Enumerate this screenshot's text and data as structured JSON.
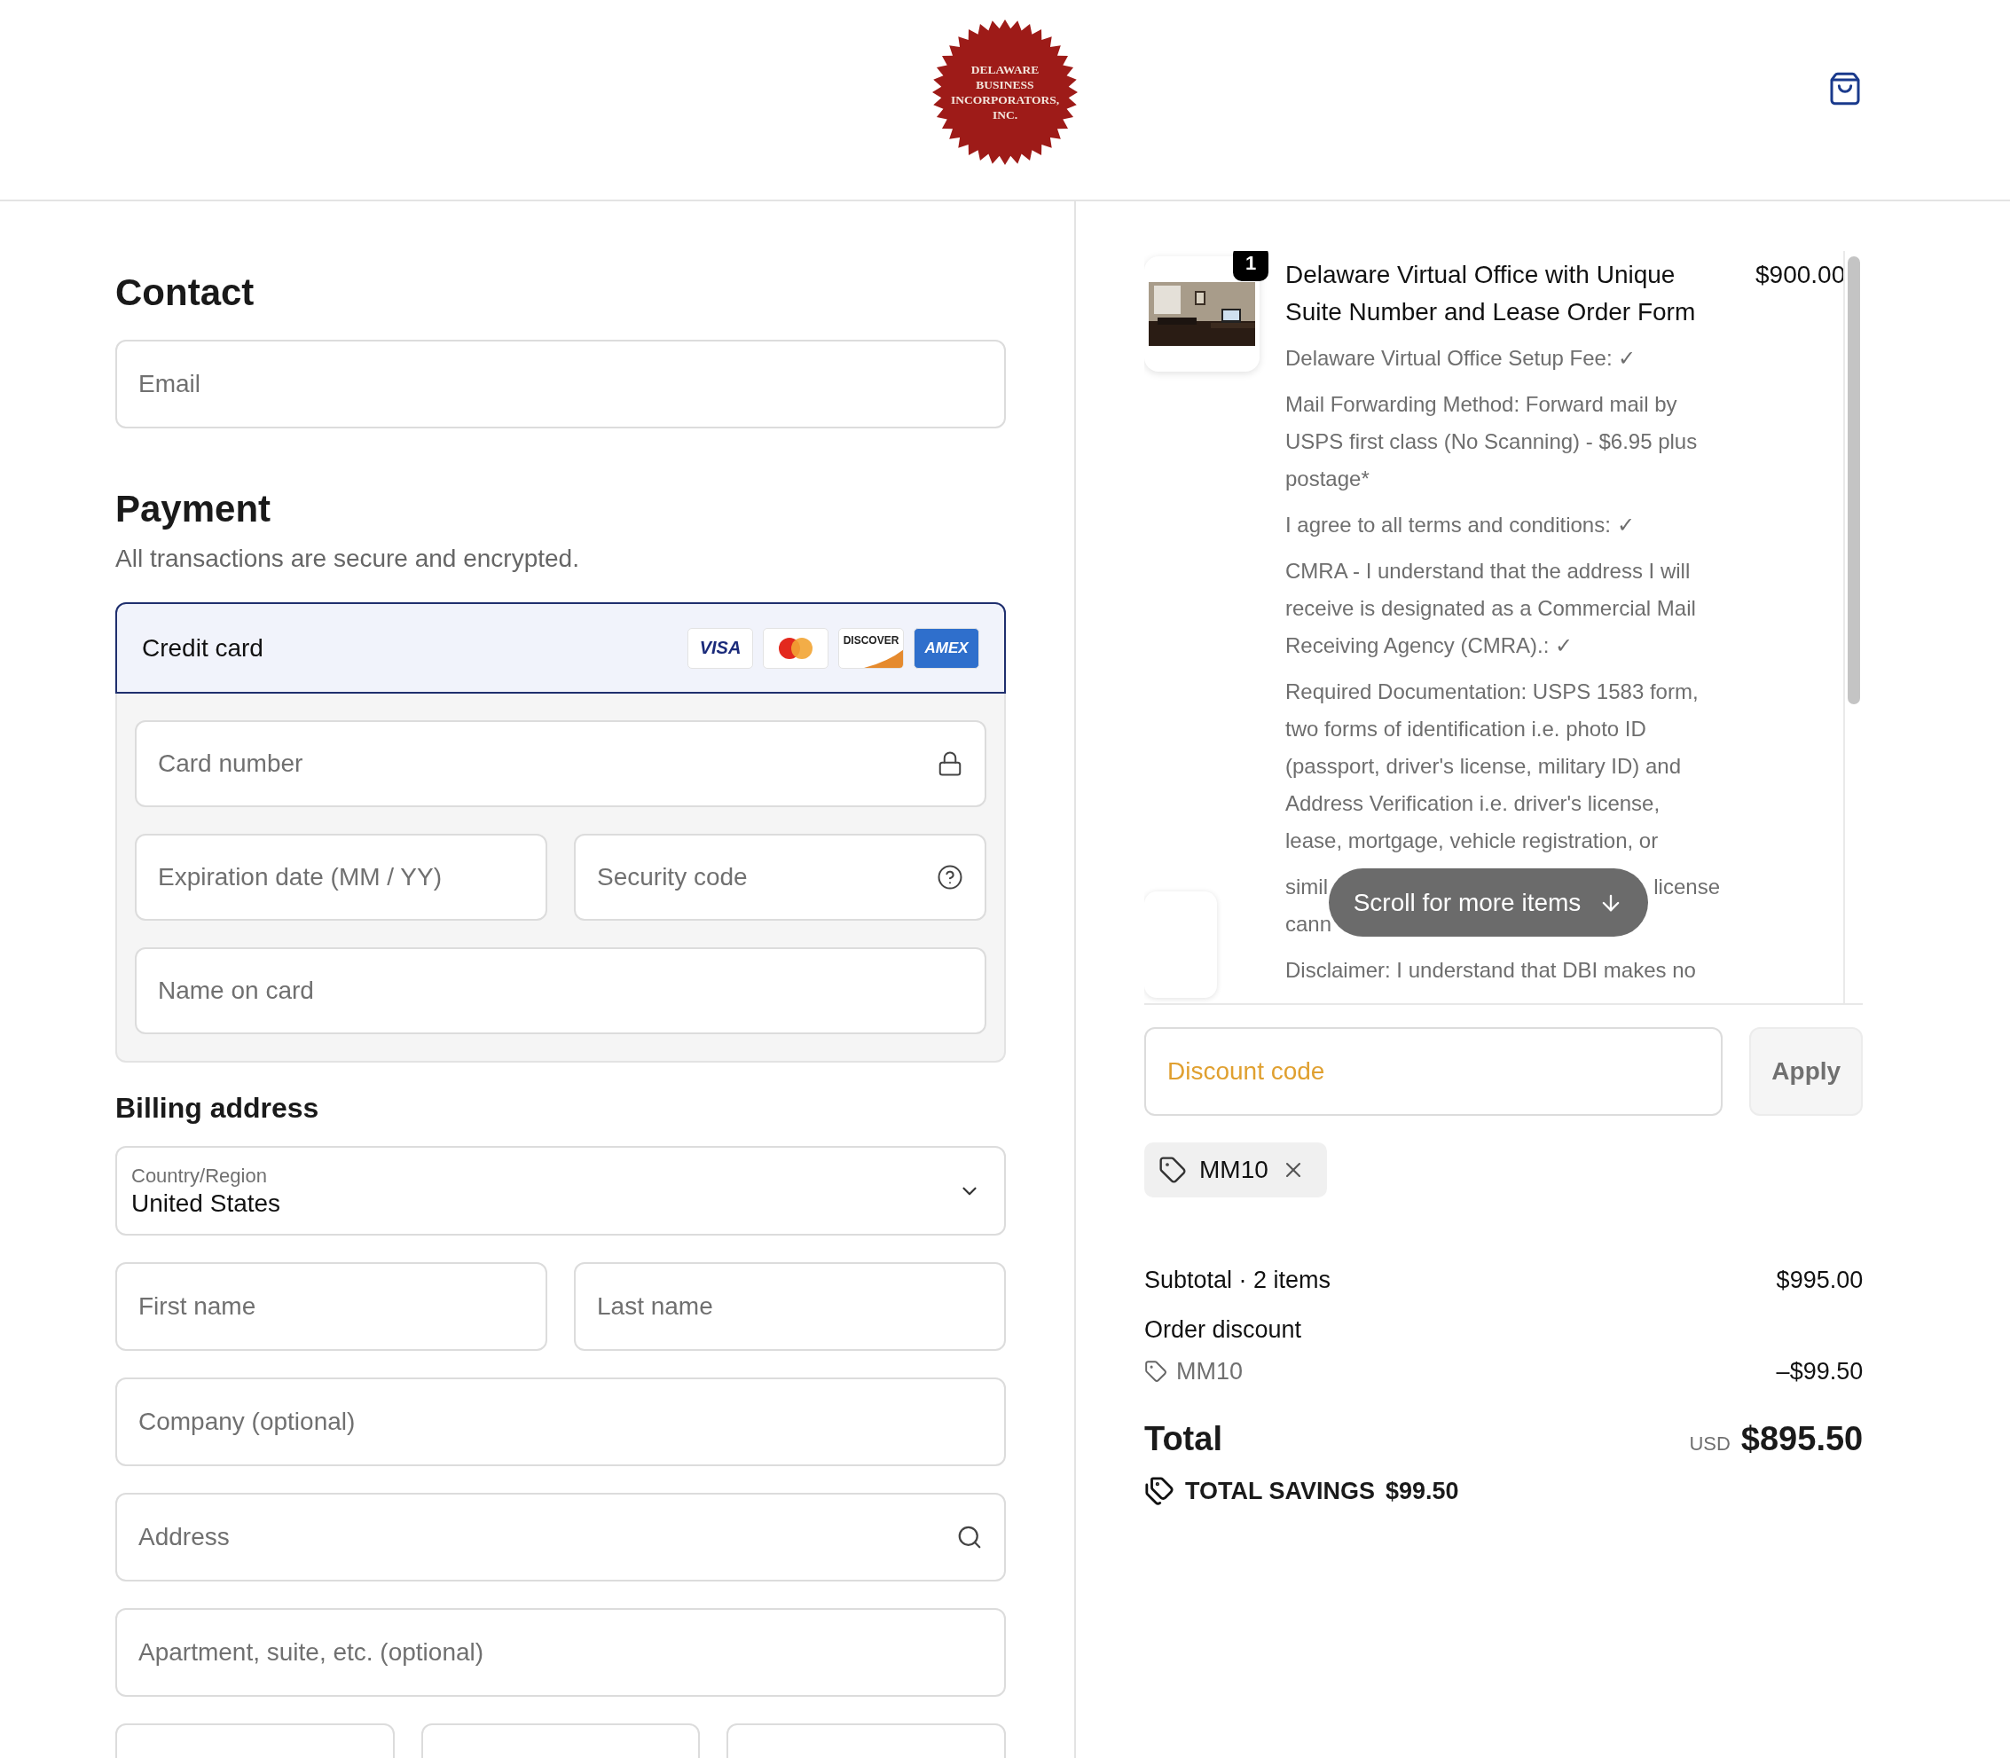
{
  "header": {
    "logo_lines": [
      "DELAWARE",
      "BUSINESS",
      "INCORPORATORS,",
      "INC."
    ]
  },
  "contact": {
    "heading": "Contact",
    "email": {
      "placeholder": "Email"
    }
  },
  "payment": {
    "heading": "Payment",
    "subtitle": "All transactions are secure and encrypted.",
    "method": {
      "label": "Credit card",
      "selected": true,
      "brands": [
        {
          "kind": "visa",
          "label": "VISA"
        },
        {
          "kind": "mastercard"
        },
        {
          "kind": "discover",
          "label": "DISCOVER"
        },
        {
          "kind": "amex",
          "label": "AMEX"
        }
      ]
    },
    "fields": [
      [
        {
          "kind": "lock",
          "placeholder": "Card number"
        }
      ],
      [
        {
          "kind": "plain",
          "placeholder": "Expiration date (MM / YY)"
        },
        {
          "kind": "help",
          "placeholder": "Security code"
        }
      ],
      [
        {
          "kind": "plain",
          "placeholder": "Name on card"
        }
      ]
    ]
  },
  "billing": {
    "heading": "Billing address",
    "country": {
      "label": "Country/Region",
      "value": "United States"
    },
    "rows": [
      [
        {
          "kind": "field",
          "placeholder": "First name"
        },
        {
          "kind": "field",
          "placeholder": "Last name"
        }
      ],
      [
        {
          "kind": "field",
          "placeholder": "Company (optional)"
        }
      ],
      [
        {
          "kind": "search",
          "placeholder": "Address"
        }
      ],
      [
        {
          "kind": "field",
          "placeholder": "Apartment, suite, etc. (optional)"
        }
      ],
      [
        {
          "kind": "cut"
        },
        {
          "kind": "cut"
        },
        {
          "kind": "cut"
        }
      ]
    ]
  },
  "order": {
    "items": [
      {
        "quantity": "1",
        "title": "Delaware Virtual Office with Unique Suite Number and Lease Order Form",
        "price": "$900.00",
        "details": [
          {
            "kind": "text",
            "text": "Delaware Virtual Office Setup Fee: ✓"
          },
          {
            "kind": "text",
            "text": "Mail Forwarding Method: Forward mail by USPS first class (No Scanning) - $6.95 plus postage*"
          },
          {
            "kind": "text",
            "text": "I agree to all terms and conditions: ✓"
          },
          {
            "kind": "text",
            "text": "CMRA - I understand that the address I will receive is designated as a Commercial Mail Receiving Agency (CMRA).: ✓"
          },
          {
            "kind": "text",
            "text": "Required Documentation: USPS 1583 form, two forms of identification i.e. photo ID (passport, driver's license, military ID) and Address Verification i.e. driver's license, lease, mortgage, vehicle registration, or"
          },
          {
            "kind": "covered",
            "left": "simil",
            "right": "license",
            "next": "cann"
          },
          {
            "kind": "text",
            "text": "Disclaimer: I understand that DBI makes no"
          }
        ]
      }
    ],
    "scroll_hint": "Scroll for more items",
    "discount": {
      "placeholder": "Discount code",
      "button": "Apply",
      "applied": "MM10"
    },
    "subtotal": {
      "label": "Subtotal · 2 items",
      "value": "$995.00"
    },
    "order_discount": {
      "label": "Order discount",
      "code": "MM10",
      "value": "–$99.50"
    },
    "total": {
      "label": "Total",
      "currency": "USD",
      "value": "$895.50"
    },
    "savings": {
      "label": "TOTAL SAVINGS",
      "value": "$99.50"
    }
  }
}
